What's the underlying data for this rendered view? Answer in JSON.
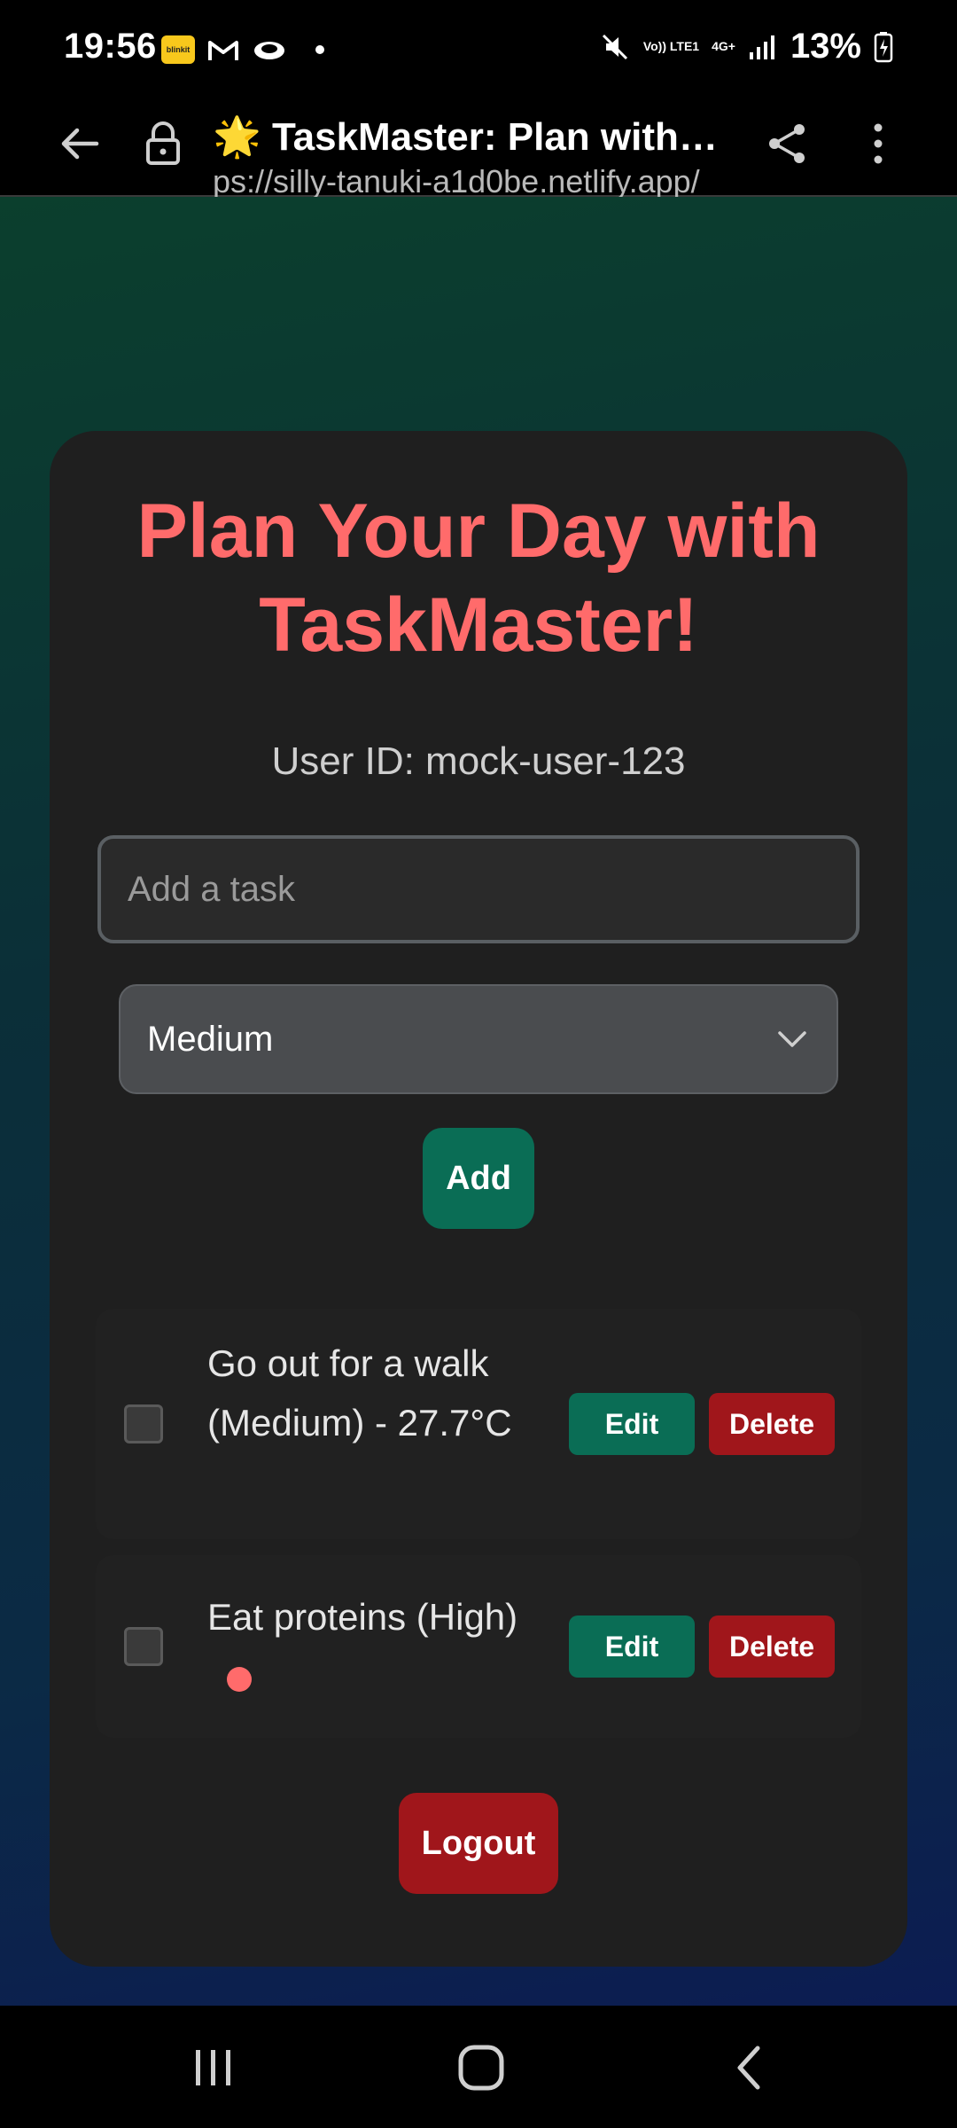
{
  "status_bar": {
    "time": "19:56",
    "app_badge": "blinkit",
    "network_top": "Vo)) LTE1",
    "network_gen": "4G+",
    "battery": "13%"
  },
  "browser": {
    "title": "🌟 TaskMaster: Plan with E...",
    "url": "ps://silly-tanuki-a1d0be.netlify.app/"
  },
  "app": {
    "heading": "Plan Your Day with TaskMaster!",
    "user_id": "User ID: mock-user-123",
    "task_input": {
      "placeholder": "Add a task",
      "value": ""
    },
    "priority_select": {
      "selected": "Medium"
    },
    "add_label": "Add",
    "tasks": [
      {
        "text": "Go out for a walk (Medium) - 27.7°C",
        "completed": false,
        "priority_indicator": false,
        "edit_label": "Edit",
        "delete_label": "Delete"
      },
      {
        "text": "Eat proteins (High)",
        "completed": false,
        "priority_indicator": true,
        "indicator_color": "#ff6b6b",
        "edit_label": "Edit",
        "delete_label": "Delete"
      }
    ],
    "logout_label": "Logout"
  },
  "colors": {
    "accent_heading": "#ff6b6b",
    "primary_button": "#0a6d55",
    "danger_button": "#a0161b",
    "card_background": "#1f1f1f"
  },
  "icons": {
    "status": [
      "blinkit-icon",
      "gmail-icon",
      "cloud-icon",
      "mute-icon",
      "signal-icon",
      "battery-charging-icon"
    ],
    "browser": [
      "back-arrow-icon",
      "lock-icon",
      "share-icon",
      "more-vert-icon"
    ],
    "nav": [
      "recents-icon",
      "home-icon",
      "back-icon"
    ]
  }
}
